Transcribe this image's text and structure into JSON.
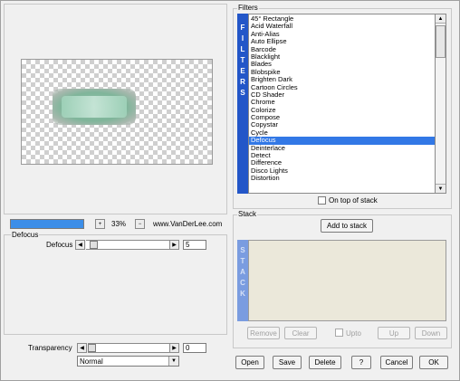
{
  "preview": {
    "zoom": "33%",
    "progress": 1.0,
    "minus": "−",
    "plus": "+",
    "credit": "www.VanDerLee.com"
  },
  "filters": {
    "group_label": "Filters",
    "side_label": "FILTERS",
    "items": [
      "45° Rectangle",
      "Acid Waterfall",
      "Anti-Alias",
      "Auto Ellipse",
      "Barcode",
      "Blacklight",
      "Blades",
      "Blobspike",
      "Brighten Dark",
      "Cartoon Circles",
      "CD Shader",
      "Chrome",
      "Colorize",
      "Compose",
      "Copystar",
      "Cycle",
      "Defocus",
      "Deinterlace",
      "Detect",
      "Difference",
      "Disco Lights",
      "Distortion"
    ],
    "selected": "Defocus",
    "on_top_label": "On top of stack",
    "on_top_checked": false
  },
  "stack": {
    "group_label": "Stack",
    "add_label": "Add to stack",
    "side_label": "STACK",
    "remove_label": "Remove",
    "clear_label": "Clear",
    "upto_label": "Upto",
    "up_label": "Up",
    "down_label": "Down"
  },
  "defocus": {
    "group_label": "Defocus",
    "param_label": "Defocus",
    "value": "5",
    "level": 0.05
  },
  "transparency": {
    "label": "Transparency",
    "value": "0",
    "level": 0.0,
    "blend_mode": "Normal"
  },
  "buttons": {
    "open": "Open",
    "save": "Save",
    "delete": "Delete",
    "help": "?",
    "cancel": "Cancel",
    "ok": "OK"
  },
  "colors": {
    "selection": "#3278e6",
    "side_panel": "#2356c8",
    "stack_panel": "#7a9ce0",
    "stack_bg": "#ebe8da",
    "progress": "#3c8ee8"
  }
}
